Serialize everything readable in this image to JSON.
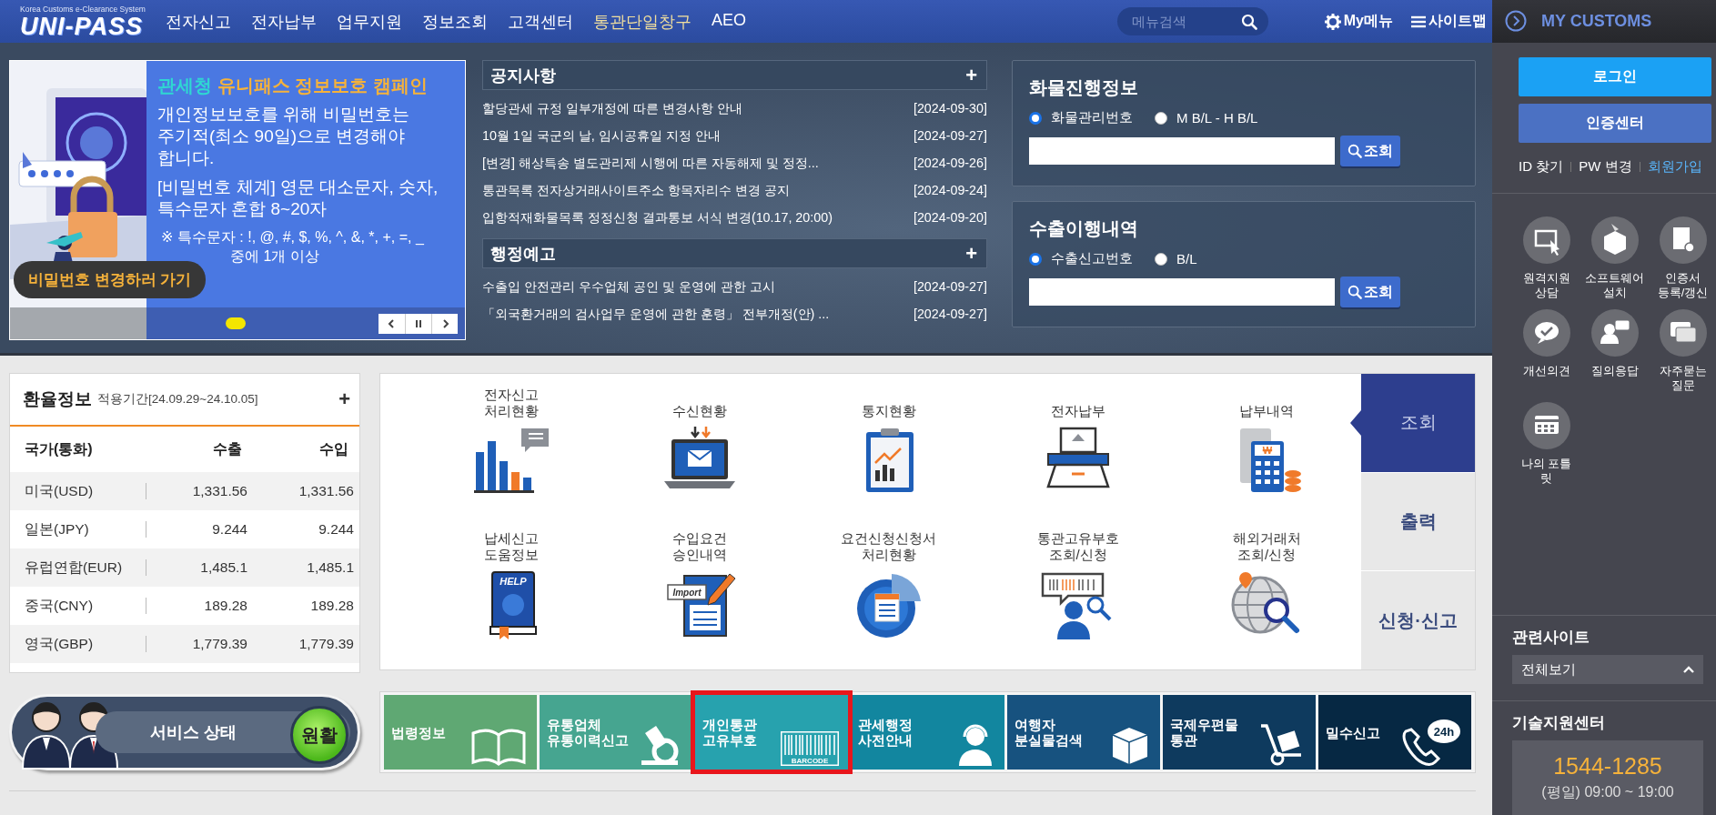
{
  "header": {
    "logo_tagline": "Korea Customs e-Clearance System",
    "logo": "UNI-PASS",
    "nav": [
      {
        "label": "전자신고",
        "highlighted": false
      },
      {
        "label": "전자납부",
        "highlighted": false
      },
      {
        "label": "업무지원",
        "highlighted": false
      },
      {
        "label": "정보조회",
        "highlighted": false
      },
      {
        "label": "고객센터",
        "highlighted": false
      },
      {
        "label": "통관단일창구",
        "highlighted": true
      },
      {
        "label": "AEO",
        "highlighted": false
      }
    ],
    "search": {
      "placeholder": "메뉴검색"
    },
    "my_menu": "My메뉴",
    "sitemap": "사이트맵"
  },
  "banner": {
    "title_org": "관세청",
    "title": "유니패스 정보보호 캠페인",
    "paragraphs": [
      "개인정보보호를 위해 비밀번호는 주기적(최소 90일)으로 변경해야 합니다.",
      "[비밀번호 체계] 영문 대소문자, 숫자, 특수문자 혼합 8~20자",
      "※ 특수문자 : !, @, #, $, %, ^, &, *, +, =, _ 중에 1개 이상"
    ],
    "cta": "비밀번호 변경하러 가기",
    "slides": [
      {
        "selected": true
      }
    ]
  },
  "notices": [
    {
      "title": "공지사항",
      "more": "+",
      "items": [
        {
          "title": "할당관세 규정 일부개정에 따른 변경사항 안내",
          "date": "[2024-09-30]"
        },
        {
          "title": "10월 1일 국군의 날, 임시공휴일 지정 안내",
          "date": "[2024-09-27]"
        },
        {
          "title": "[변경] 해상특송 별도관리제 시행에 따른 자동해제 및 정정...",
          "date": "[2024-09-26]"
        },
        {
          "title": "통관목록 전자상거래사이트주소 항목자리수 변경 공지",
          "date": "[2024-09-24]"
        },
        {
          "title": "입항적재화물목록 정정신청 결과통보 서식 변경(10.17, 20:00)",
          "date": "[2024-09-20]"
        }
      ]
    },
    {
      "title": "행정예고",
      "more": "+",
      "items": [
        {
          "title": "수출입 안전관리 우수업체 공인 및 운영에 관한 고시",
          "date": "[2024-09-27]"
        },
        {
          "title": "「외국환거래의 검사업무 운영에 관한 훈령」 전부개정(안) ...",
          "date": "[2024-09-27]"
        }
      ]
    }
  ],
  "lookups": [
    {
      "title": "화물진행정보",
      "options": [
        {
          "label": "화물관리번호",
          "selected": true
        },
        {
          "label": "M B/L - H B/L",
          "selected": false
        }
      ],
      "button": "조회"
    },
    {
      "title": "수출이행내역",
      "options": [
        {
          "label": "수출신고번호",
          "selected": true
        },
        {
          "label": "B/L",
          "selected": false
        }
      ],
      "button": "조회"
    }
  ],
  "rates": {
    "title": "환율정보",
    "period": "적용기간[24.09.29~24.10.05]",
    "more": "+",
    "columns": [
      "국가(통화)",
      "수출",
      "수입"
    ],
    "rows": [
      [
        "미국(USD)",
        "1,331.56",
        "1,331.56"
      ],
      [
        "일본(JPY)",
        "9.244",
        "9.244"
      ],
      [
        "유럽연합(EUR)",
        "1,485.1",
        "1,485.1"
      ],
      [
        "중국(CNY)",
        "189.28",
        "189.28"
      ],
      [
        "영국(GBP)",
        "1,779.39",
        "1,779.39"
      ]
    ]
  },
  "service_status": {
    "label": "서비스 상태",
    "status": "원활"
  },
  "services": [
    {
      "label": "전자신고\n처리현황",
      "kind": "chart"
    },
    {
      "label": "수신현황",
      "kind": "laptop"
    },
    {
      "label": "통지현황",
      "kind": "clipboard"
    },
    {
      "label": "전자납부",
      "kind": "terminal"
    },
    {
      "label": "납부내역",
      "kind": "calculator",
      "icon_text": "₩"
    },
    {
      "label": "납세신고\n도움정보",
      "kind": "book",
      "icon_text": "HELP"
    },
    {
      "label": "수입요건\n승인내역",
      "kind": "form",
      "icon_text": "Import"
    },
    {
      "label": "요건신청신청서\n처리현황",
      "kind": "pie"
    },
    {
      "label": "통관고유부호\n조회/신청",
      "kind": "barcode"
    },
    {
      "label": "해외거래처\n조회/신청",
      "kind": "globe"
    }
  ],
  "service_tabs": [
    {
      "label": "조회",
      "selected": true
    },
    {
      "label": "출력",
      "selected": false
    },
    {
      "label": "신청·신고",
      "selected": false
    }
  ],
  "tiles": [
    {
      "label": "법령정보",
      "color": "#5fa873",
      "kind": "book",
      "highlighted": false
    },
    {
      "label": "유통업체\n유통이력신고",
      "color": "#46a590",
      "kind": "stamp",
      "highlighted": false
    },
    {
      "label": "개인통관\n고유부호",
      "color": "#27a2ae",
      "kind": "barcode",
      "icon_text": "BARCODE",
      "highlighted": true
    },
    {
      "label": "관세행정\n사전안내",
      "color": "#12869f",
      "kind": "headset",
      "highlighted": false
    },
    {
      "label": "여행자\n분실물검색",
      "color": "#17527f",
      "kind": "package",
      "highlighted": false
    },
    {
      "label": "국제우편물\n통관",
      "color": "#0e3a5e",
      "kind": "cart",
      "highlighted": false
    },
    {
      "label": "밀수신고",
      "color": "#062843",
      "kind": "phone",
      "icon_text": "24h",
      "highlighted": false
    }
  ],
  "sidebar": {
    "title": "MY CUSTOMS",
    "buttons": [
      {
        "label": "로그인",
        "kind": "primary"
      },
      {
        "label": "인증센터",
        "kind": "secondary"
      }
    ],
    "links": [
      {
        "label": "ID 찾기",
        "highlighted": false
      },
      {
        "label": "PW 변경",
        "highlighted": false
      },
      {
        "label": "회원가입",
        "highlighted": true
      }
    ],
    "quick": [
      {
        "label": "원격지원\n상담",
        "kind": "monitor"
      },
      {
        "label": "소프트웨어\n설치",
        "kind": "box"
      },
      {
        "label": "인증서\n등록/갱신",
        "kind": "certificate"
      },
      {
        "label": "개선의견",
        "kind": "chat"
      },
      {
        "label": "질의응답",
        "kind": "user"
      },
      {
        "label": "자주묻는\n질문",
        "kind": "messages"
      },
      {
        "label": "나의 포틀릿",
        "kind": "card"
      }
    ],
    "related": {
      "title": "관련사이트",
      "select": "전체보기"
    },
    "support": {
      "title": "기술지원센터",
      "phone": "1544-1285",
      "hours": "(평일) 09:00 ~ 19:00"
    }
  }
}
